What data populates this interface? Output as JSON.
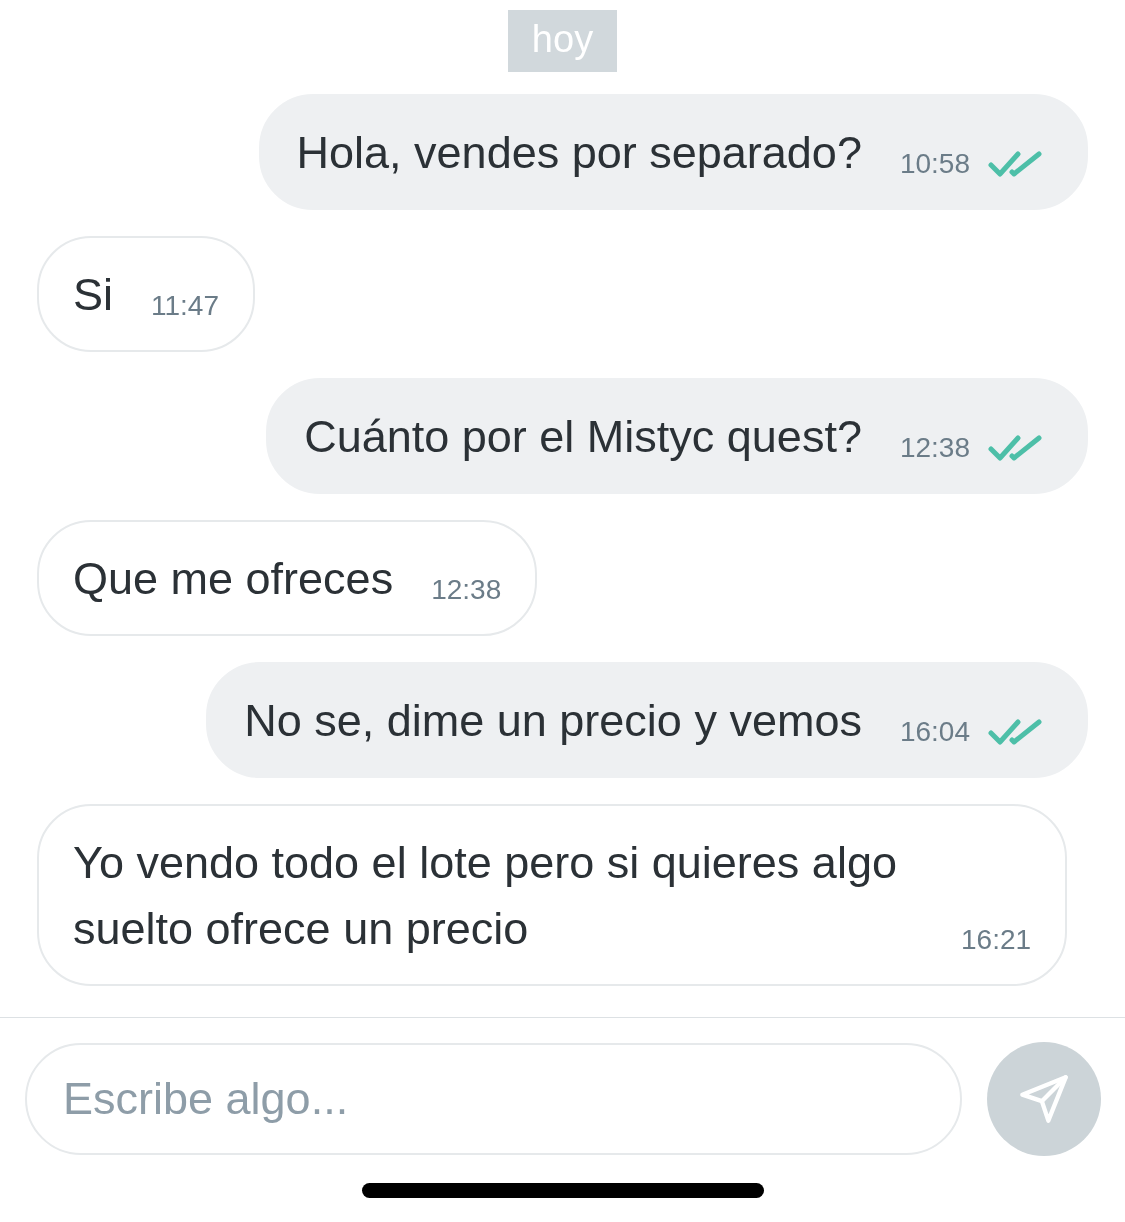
{
  "date_chip": "hoy",
  "messages": [
    {
      "kind": "outgoing",
      "text": "Hola, vendes por separado?",
      "time": "10:58",
      "read": true
    },
    {
      "kind": "incoming",
      "text": "Si",
      "time": "11:47"
    },
    {
      "kind": "outgoing",
      "text": "Cuánto por el Mistyc quest?",
      "time": "12:38",
      "read": true
    },
    {
      "kind": "incoming",
      "text": "Que me ofreces",
      "time": "12:38"
    },
    {
      "kind": "outgoing",
      "text": "No se, dime un precio y vemos",
      "time": "16:04",
      "read": true
    },
    {
      "kind": "incoming",
      "text": "Yo vendo todo el lote pero si quieres algo suelto ofrece un precio",
      "time": "16:21"
    }
  ],
  "composer": {
    "placeholder": "Escribe algo..."
  }
}
